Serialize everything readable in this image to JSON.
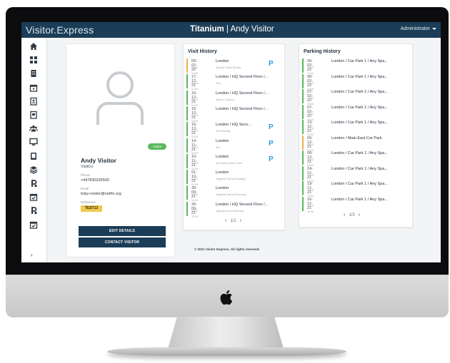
{
  "header": {
    "brand": "Visitor.Express",
    "title_bold": "Titanium",
    "title_rest": " | Andy Visitor",
    "user_menu": "Administrator"
  },
  "sidebar": {
    "items": [
      {
        "icon": "home-icon"
      },
      {
        "icon": "dashboard-icon"
      },
      {
        "icon": "building-icon"
      },
      {
        "icon": "calendar-icon"
      },
      {
        "icon": "id-badge-icon"
      },
      {
        "icon": "id-card-icon"
      },
      {
        "icon": "users-icon"
      },
      {
        "icon": "monitor-icon"
      },
      {
        "icon": "tablet-icon"
      },
      {
        "icon": "layers-icon"
      },
      {
        "icon": "parking-icon"
      },
      {
        "icon": "calendar-check-icon"
      },
      {
        "icon": "parking-icon"
      },
      {
        "icon": "calendar-check-icon"
      }
    ],
    "expand": "›"
  },
  "profile": {
    "status": "Visitor",
    "name": "Andy Visitor",
    "company": "VisitCo",
    "phone_label": "Phone",
    "phone": "+447830235500",
    "email_label": "Email",
    "email": "toby+visitor@netfm.org",
    "ref_label": "Reference",
    "ref": "TEST13",
    "edit_button": "EDIT DETAILS",
    "contact_button": "CONTACT VISITOR"
  },
  "visit_history": {
    "title": "Visit History",
    "rows": [
      {
        "date": "09-02-22",
        "time": "09:00 - 12:00",
        "location": "London",
        "sub": "Monthly Sales Review",
        "parking": true,
        "color": "#f0ad4e"
      },
      {
        "date": "17-12-21",
        "time": "09:00 - 13:00",
        "location": "London / HQ Second Floor /...",
        "sub": "Test",
        "parking": false,
        "color": "#5cb85c"
      },
      {
        "date": "16-12-21",
        "time": "09:00 - 13:00",
        "location": "London / HQ Second Floor /...",
        "sub": "Sales & Support",
        "parking": false,
        "color": "#5cb85c"
      },
      {
        "date": "15-12-21",
        "time": "12:00 - 18:00",
        "location": "London / HQ Second Floor /...",
        "sub": "",
        "parking": false,
        "color": "#5cb85c"
      },
      {
        "date": "15-12-21",
        "time": "09:00 - 13:00",
        "location": "London / HQ Seco...",
        "sub": "Test Meeting",
        "parking": true,
        "color": "#5cb85c"
      },
      {
        "date": "14-11-21",
        "time": "15:30 - 18:00",
        "location": "London",
        "sub": "test",
        "parking": true,
        "color": "#5cb85c"
      },
      {
        "date": "10-11-21",
        "time": "14:00 - 15:00",
        "location": "London",
        "sub": "test visitor profile zoom",
        "parking": true,
        "color": "#5cb85c"
      },
      {
        "date": "01-10-21",
        "time": "11:00 - 12:00",
        "location": "London",
        "sub": "Regional Roll-out Strategy",
        "parking": false,
        "color": "#5cb85c"
      },
      {
        "date": "30-09-21",
        "time": "09:00 - 12:00",
        "location": "London",
        "sub": "Regional Roll-out Planning",
        "parking": false,
        "color": "#5cb85c"
      },
      {
        "date": "30-09-21",
        "time": "09:00 - 12:00",
        "location": "London / HQ Second Floor /...",
        "sub": "regional roll-out planning",
        "parking": false,
        "color": "#5cb85c"
      }
    ],
    "pager": "1/1"
  },
  "parking_history": {
    "title": "Parking History",
    "rows": [
      {
        "date": "09-02-22",
        "time": "10:00 - 12:00",
        "location": "London / Car Park 1 / Any Spa...",
        "color": "#5cb85c"
      },
      {
        "date": "08-02-22",
        "time": "10:00 - 13:00",
        "location": "London / Car Park 1 / Any Spa...",
        "color": "#5cb85c"
      },
      {
        "date": "07-02-22",
        "time": "14:30 - 18:00",
        "location": "London / Car Park 1 / Any Spa...",
        "color": "#5cb85c"
      },
      {
        "date": "07-02-22",
        "time": "14:30 - 18:00",
        "location": "London / Car Park 1 / Any Spa...",
        "color": "#5cb85c"
      },
      {
        "date": "13-12-21",
        "time": "07:30 - 18:00",
        "location": "London / Car Park 1 / Any Spa...",
        "color": "#5cb85c"
      },
      {
        "date": "09-12-21",
        "time": "09:00 - 09:00",
        "location": "London / Main East Car Park",
        "color": "#f0ad4e"
      },
      {
        "date": "08-12-21",
        "time": "08:00 - 18:00",
        "location": "London / Car Park 1 / Any Spa...",
        "color": "#5cb85c"
      },
      {
        "date": "24-11-21",
        "time": "10:00 - 12:30",
        "location": "London / Car Park 1 / Any Spa...",
        "color": "#5cb85c"
      },
      {
        "date": "19-11-21",
        "time": "14:30 - 18:00",
        "location": "London / Car Park 1 / Any Spa...",
        "color": "#5cb85c"
      },
      {
        "date": "16-11-21",
        "time": "10:30 - 16:30",
        "location": "London / Car Park 1 / Any Spa...",
        "color": "#5cb85c"
      }
    ],
    "pager": "1/3"
  },
  "footer": {
    "copyright": "© 2021 Visitor Express. All rights reserved."
  },
  "colors": {
    "navy": "#1b3d57",
    "parking_blue": "#3a9bdc",
    "badge_green": "#5bb85c",
    "ref_yellow": "#f2c94c"
  }
}
